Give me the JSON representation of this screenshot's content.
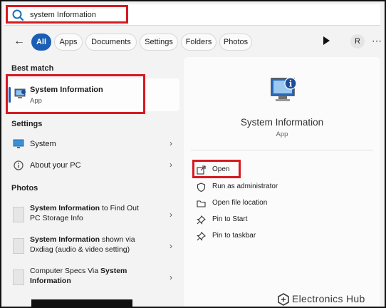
{
  "search": {
    "value": "system Information",
    "icon": "search-icon"
  },
  "filters": {
    "back_icon": "←",
    "tabs": [
      "All",
      "Apps",
      "Documents",
      "Settings",
      "Folders",
      "Photos"
    ],
    "avatar_initial": "R",
    "more_icon": "⋯",
    "accent_color": "#1a5fb4"
  },
  "left": {
    "best_match_heading": "Best match",
    "best_match": {
      "title": "System Information",
      "subtitle": "App"
    },
    "settings_heading": "Settings",
    "settings_items": [
      {
        "label": "System",
        "icon": "monitor-icon"
      },
      {
        "label": "About your PC",
        "icon": "info-circle-icon"
      }
    ],
    "photos_heading": "Photos",
    "photo_items": [
      {
        "line1_bold": "System Information",
        "line1_rest": " to Find Out",
        "line2": "PC Storage Info"
      },
      {
        "line1_bold": "System Information",
        "line1_rest": " shown via",
        "line2": "Dxdiag (audio & video setting)"
      },
      {
        "line1_rest_pre": "Computer Specs Via ",
        "line1_bold": "System",
        "line2_bold": "Information"
      }
    ],
    "chevron": "›"
  },
  "right": {
    "title": "System Information",
    "subtitle": "App",
    "actions": [
      {
        "label": "Open",
        "icon": "external-link-icon"
      },
      {
        "label": "Run as administrator",
        "icon": "shield-icon"
      },
      {
        "label": "Open file location",
        "icon": "folder-icon"
      },
      {
        "label": "Pin to Start",
        "icon": "pin-icon"
      },
      {
        "label": "Pin to taskbar",
        "icon": "pin-icon"
      }
    ]
  },
  "watermark": {
    "text": "Electronics Hub"
  },
  "highlight_color": "#d71920"
}
